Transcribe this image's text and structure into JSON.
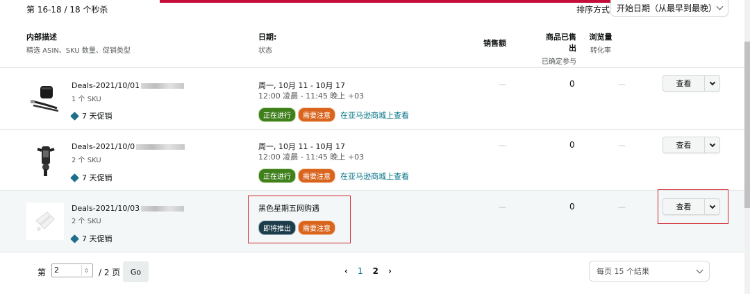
{
  "topbar": {
    "result_count": "第 16-18 / 18 个秒杀",
    "sort_label": "排序方式",
    "sort_value": "开始日期（从最早到最晚）"
  },
  "columns": {
    "desc_title": "内部描述",
    "desc_sub": "精选 ASIN、SKU 数量、促销类型",
    "date_title": "日期:",
    "date_sub": "状态",
    "sales_title": "销售额",
    "sold_title": "商品已售出",
    "sold_sub": "已确定参与",
    "views_title": "浏览量",
    "views_sub": "转化率"
  },
  "rows": [
    {
      "name": "Deals-2021/10/01",
      "sku": "1 个 SKU",
      "promo": "7 天促销",
      "date_main": "周一, 10月 11 - 10月 17",
      "date_sub": "12:00 凌晨 - 11:45 晚上 +03",
      "badge1": "正在进行",
      "badge2": "需要注意",
      "link": "在亚马逊商城上查看",
      "sales": "—",
      "sold": "0",
      "views": "—",
      "view_btn": "查看"
    },
    {
      "name": "Deals-2021/10/0",
      "sku": "2 个 SKU",
      "promo": "7 天促销",
      "date_main": "周一, 10月 11 - 10月 17",
      "date_sub": "12:00 凌晨 - 11:45 晚上 +03",
      "badge1": "正在进行",
      "badge2": "需要注意",
      "link": "在亚马逊商城上查看",
      "sales": "—",
      "sold": "0",
      "views": "—",
      "view_btn": "查看"
    },
    {
      "name": "Deals-2021/10/03",
      "sku": "2 个 SKU",
      "promo": "7 天促销",
      "title": "黑色星期五网购遇",
      "badge1": "即将推出",
      "badge2": "需要注意",
      "sales": "—",
      "sold": "0",
      "views": "—",
      "view_btn": "查看"
    }
  ],
  "footer": {
    "page_prefix": "第",
    "page_value": "2",
    "page_total": "/ 2 页",
    "go": "Go",
    "prev": "‹",
    "page1": "1",
    "page2": "2",
    "next": "›",
    "per_page": "每页 15 个结果"
  },
  "colors": {
    "accent_bar": "#c40e3a",
    "badge_active": "#3f7f1c",
    "badge_attention": "#d9641e",
    "badge_upcoming": "#1d3c4a",
    "link": "#007185",
    "highlight_box": "#d0262b"
  }
}
